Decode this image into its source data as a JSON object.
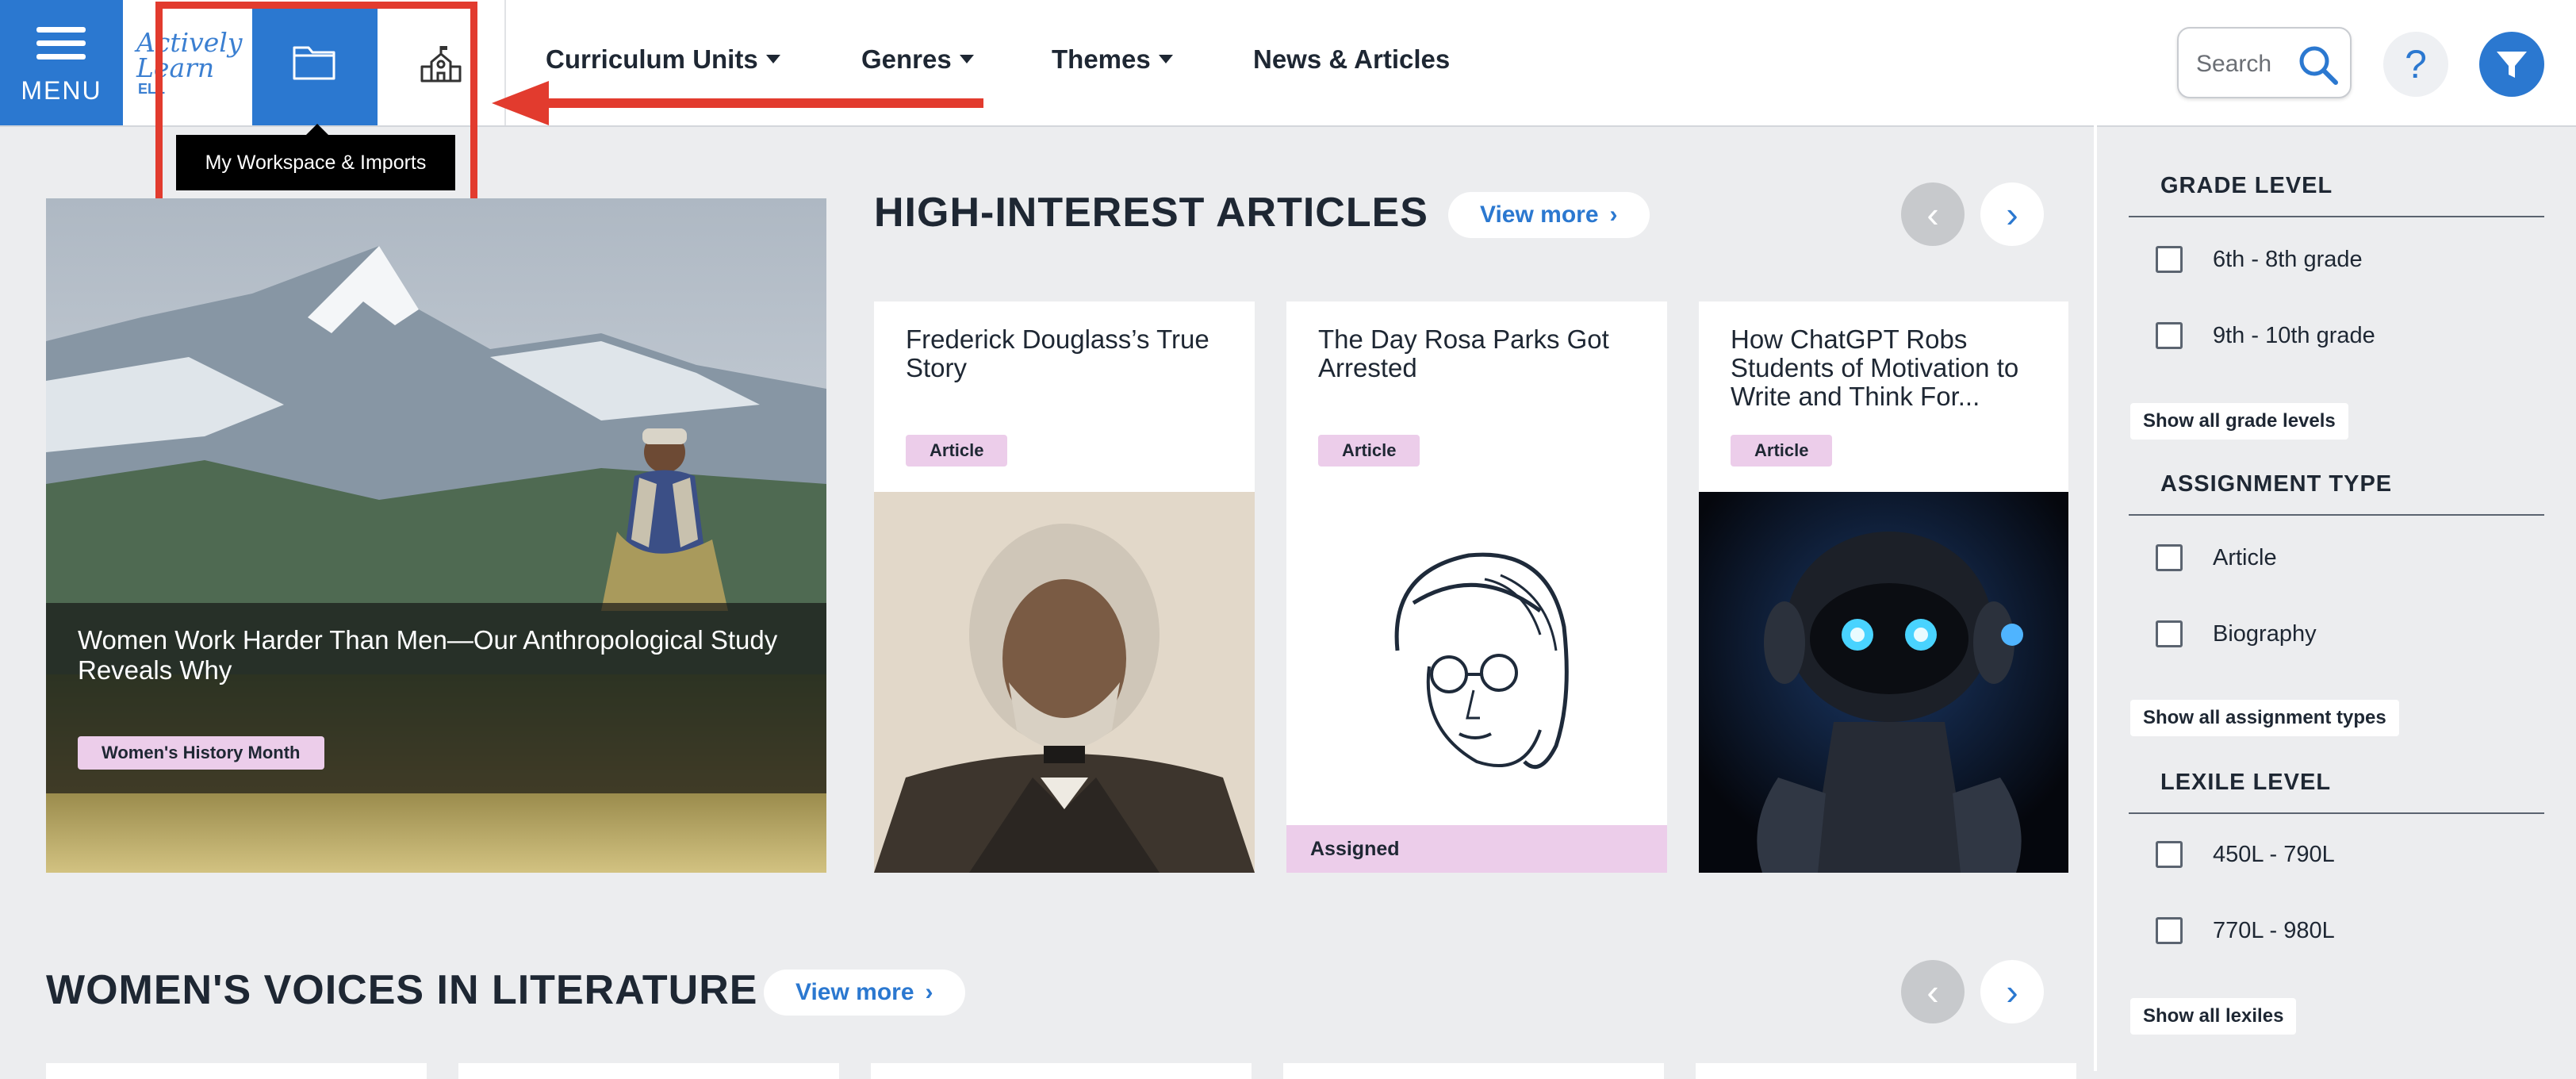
{
  "menu": {
    "label": "MENU"
  },
  "logo": {
    "line1": "Actively",
    "line2": "Learn",
    "line3": "ELL"
  },
  "tooltip": "My Workspace & Imports",
  "nav": [
    {
      "label": "Curriculum Units",
      "has_dropdown": true
    },
    {
      "label": "Genres",
      "has_dropdown": true
    },
    {
      "label": "Themes",
      "has_dropdown": true
    },
    {
      "label": "News & Articles",
      "has_dropdown": false
    }
  ],
  "search": {
    "placeholder": "Search"
  },
  "help": {
    "label": "?"
  },
  "colors": {
    "brand_blue": "#2b78d0",
    "badge_pink": "#eccdea",
    "annotation_red": "#e23b2e"
  },
  "hero": {
    "title": "Women Work Harder Than Men—Our Anthropological Study Reveals Why",
    "tag": "Women's History Month"
  },
  "section1": {
    "title": "HIGH-INTEREST ARTICLES",
    "view_more": "View more",
    "cards": [
      {
        "title": "Frederick Douglass’s True Story",
        "badge": "Article"
      },
      {
        "title": "The Day Rosa Parks Got Arrested",
        "badge": "Article",
        "status": "Assigned"
      },
      {
        "title": "How ChatGPT Robs Students of Motivation to Write and Think For...",
        "badge": "Article"
      }
    ]
  },
  "section2": {
    "title": "WOMEN'S VOICES IN LITERATURE",
    "view_more": "View more"
  },
  "filters": {
    "grade": {
      "heading": "GRADE LEVEL",
      "options": [
        "6th - 8th grade",
        "9th - 10th grade"
      ],
      "show_all": "Show all grade levels"
    },
    "type": {
      "heading": "ASSIGNMENT TYPE",
      "options": [
        "Article",
        "Biography"
      ],
      "show_all": "Show all assignment types"
    },
    "lexile": {
      "heading": "LEXILE LEVEL",
      "options": [
        "450L - 790L",
        "770L - 980L"
      ],
      "show_all": "Show all lexiles"
    }
  }
}
